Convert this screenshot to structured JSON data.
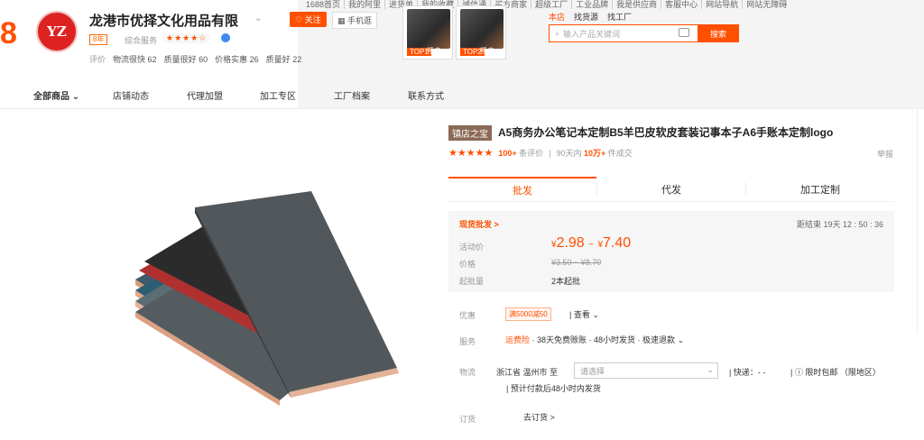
{
  "brand_partial": "8",
  "shop": {
    "logo_text": "YZ",
    "name": "龙港市优择文化用品有限",
    "years": "8年",
    "service_label": "综合服务",
    "stars": "★★★★☆",
    "scores": [
      {
        "label": "评价",
        "value": ""
      },
      {
        "label": "物流很快",
        "value": "62"
      },
      {
        "label": "质量很好",
        "value": "60"
      },
      {
        "label": "价格实惠",
        "value": "26"
      },
      {
        "label": "质量好",
        "value": "22"
      }
    ],
    "follow_label": "关注",
    "mobile_label": "手机逛"
  },
  "top_nav": [
    "1688首页",
    "我的阿里",
    "进货单",
    "我的收藏",
    "诚信通",
    "买方商家",
    "超级工厂",
    "工业品牌",
    "我是供应商",
    "客服中心",
    "网站导航",
    "网站无障碍"
  ],
  "top_products": [
    {
      "tag": "TOP1",
      "text": "畅卖"
    },
    {
      "tag": "TOP2",
      "text": "畅卖"
    }
  ],
  "search": {
    "tabs": [
      "本店",
      "找货源",
      "找工厂"
    ],
    "placeholder": "输入产品关键词",
    "button": "搜索"
  },
  "shop_nav": [
    "全部商品",
    "店铺动态",
    "代理加盟",
    "加工专区",
    "工厂档案",
    "联系方式"
  ],
  "product": {
    "badge": "镇店之宝",
    "title": "A5商务办公笔记本定制B5羊巴皮软皮套装记事本子A6手账本定制logo",
    "stars": "★★★★★",
    "review_count": "100+",
    "review_label": "条评价",
    "sales_period": "90天内",
    "sales_count": "10万+",
    "sales_label": "件成交",
    "report": "举报"
  },
  "tabs": [
    "批发",
    "代发",
    "加工定制"
  ],
  "price_panel": {
    "deal_label": "现货批发 >",
    "countdown": "距结束 19天 12 : 50 : 36",
    "activity_label": "活动价",
    "price_low": "2.98",
    "price_high": "7.40",
    "price_sep": "~",
    "currency": "¥",
    "price_label": "价格",
    "orig_price": "¥3.50 ~ ¥8.70",
    "moq_label": "起批量",
    "moq": "2本起批"
  },
  "details": {
    "promo_label": "优惠",
    "coupon": "满5000减50",
    "view_more": "查看",
    "service_label": "服务",
    "service_hl": "运费险",
    "service_rest": "· 38天免费赊账 · 48小时发货 · 极速退款",
    "logistics_label": "物流",
    "ship_from": "浙江省 温州市 至",
    "ship_select_placeholder": "请选择",
    "express": "快递：- -",
    "limit_free": "限时包邮 （限地区）",
    "delivery_time": "预计付款后48小时内发货",
    "order_label": "订货",
    "order_link": "去订货 >"
  },
  "colors": {
    "accent": "#ff5000",
    "badge_brown": "#8a6a55"
  }
}
